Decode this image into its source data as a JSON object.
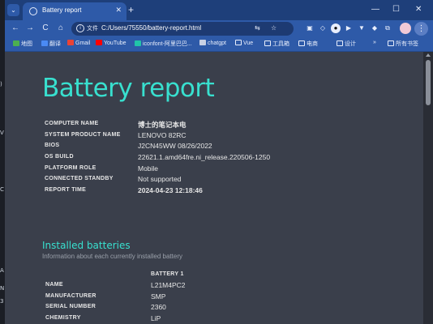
{
  "browser": {
    "tab": {
      "title": "Battery report",
      "close": "✕"
    },
    "new_tab": "+",
    "window_controls": {
      "minimize": "—",
      "maximize": "☐",
      "close": "✕"
    },
    "toolbar": {
      "back": "←",
      "forward": "→",
      "reload": "C",
      "home": "⌂",
      "security_chip": "文件",
      "url": "C:/Users/75550/battery-report.html",
      "menu": "⋮"
    },
    "bookmarks": [
      {
        "label": "地图",
        "icon": "map-icon",
        "color": "#4caf50"
      },
      {
        "label": "翻译",
        "icon": "translate-icon",
        "color": "#4a8af4"
      },
      {
        "label": "Gmail",
        "icon": "gmail-icon",
        "color": "#ea4335"
      },
      {
        "label": "YouTube",
        "icon": "youtube-icon",
        "color": "#ff0000"
      },
      {
        "label": "iconfont-阿里巴巴...",
        "icon": "iconfont-icon",
        "color": "#21c4a8"
      },
      {
        "label": "chatgpt",
        "icon": "chatgpt-icon",
        "color": "#c9d1e4"
      },
      {
        "label": "Vue",
        "icon": "folder-icon",
        "color": "#e8eefc"
      },
      {
        "label": "工具箱",
        "icon": "folder-icon",
        "color": "#e8eefc"
      },
      {
        "label": "电商",
        "icon": "folder-icon",
        "color": "#e8eefc"
      },
      {
        "label": "设计",
        "icon": "folder-icon",
        "color": "#e8eefc"
      }
    ],
    "bookmarks_more": "»",
    "all_bookmarks": "所有书签"
  },
  "report": {
    "title": "Battery report",
    "info": [
      {
        "label": "COMPUTER NAME",
        "value": "博士的笔记本电",
        "bold": true
      },
      {
        "label": "SYSTEM PRODUCT NAME",
        "value": "LENOVO 82RC",
        "bold": false
      },
      {
        "label": "BIOS",
        "value": "J2CN45WW 08/26/2022",
        "bold": false
      },
      {
        "label": "OS BUILD",
        "value": "22621.1.amd64fre.ni_release.220506-1250",
        "bold": false
      },
      {
        "label": "PLATFORM ROLE",
        "value": "Mobile",
        "bold": false
      },
      {
        "label": "CONNECTED STANDBY",
        "value": "Not supported",
        "bold": false
      },
      {
        "label": "REPORT TIME",
        "value": "2024-04-23   12:18:46",
        "bold": true
      }
    ],
    "installed": {
      "title": "Installed batteries",
      "subtitle": "Information about each currently installed battery",
      "column": "BATTERY 1",
      "rows": [
        {
          "label": "NAME",
          "value": "L21M4PC2"
        },
        {
          "label": "MANUFACTURER",
          "value": "SMP"
        },
        {
          "label": "SERIAL NUMBER",
          "value": "2360"
        },
        {
          "label": "CHEMISTRY",
          "value": "LiP"
        }
      ]
    }
  },
  "colors": {
    "accent": "#38e0cf",
    "chrome": "#2e5aa8",
    "page_bg": "#3a3f4b"
  }
}
